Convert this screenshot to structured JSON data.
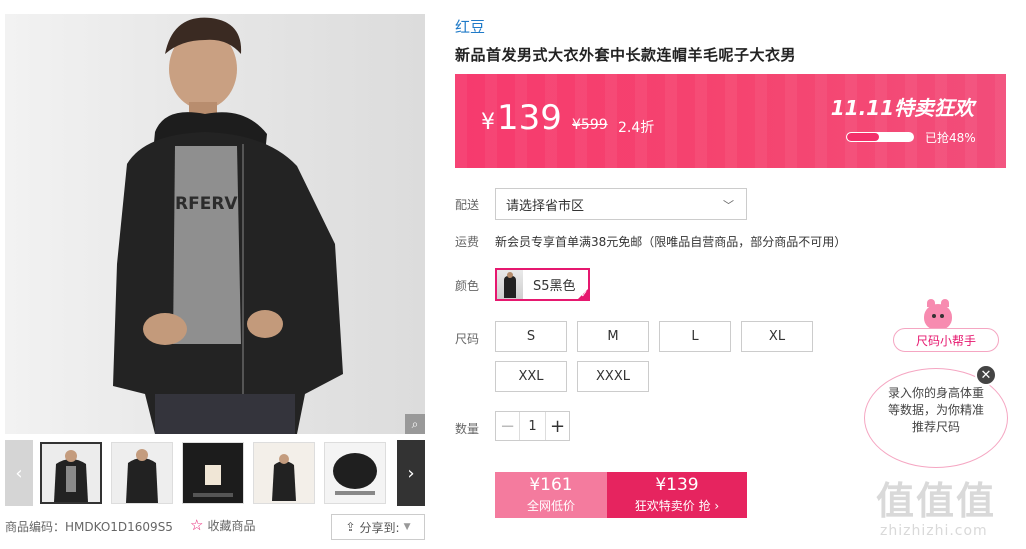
{
  "gallery": {
    "thumb_count": 6,
    "active_thumb": 0,
    "prev_arrow": "‹",
    "next_arrow": "›",
    "zoom_icon": "magnifier-icon"
  },
  "product": {
    "brand": "红豆",
    "title": "新品首发男式大衣外套中长款连帽羊毛呢子大衣男",
    "sku_label": "商品编码：HMDKO1D1609S5",
    "favorite_label": "收藏商品",
    "share_label": "分享到:"
  },
  "price": {
    "currency": "¥",
    "current": "139",
    "original": "¥599",
    "discount": "2.4折",
    "event_title": "11.11特卖狂欢",
    "sold_text": "已抢48%",
    "sold_fraction": 0.48
  },
  "delivery": {
    "label": "配送",
    "region_placeholder": "请选择省市区",
    "shipping_label": "运费",
    "shipping_text": "新会员专享首单满38元免邮（限唯品自营商品，部分商品不可用）"
  },
  "color": {
    "label": "颜色",
    "selected": "S5黑色"
  },
  "size": {
    "label": "尺码",
    "options": [
      "S",
      "M",
      "L",
      "XL",
      "XXL",
      "XXXL"
    ]
  },
  "quantity": {
    "label": "数量",
    "value": "1",
    "minus": "−",
    "plus": "+"
  },
  "buy": {
    "left_price": "¥161",
    "left_label": "全网低价",
    "right_price": "¥139",
    "right_label": "狂欢特卖价 抢 ›"
  },
  "size_helper": {
    "tag": "尺码小帮手",
    "bubble": "录入你的身高体重等数据，为你精准推荐尺码",
    "close": "✕"
  },
  "watermark": {
    "mark": "值值值",
    "url": "zhizhizhi.com"
  },
  "colors": {
    "accent": "#e6186f",
    "banner": "#f5446f",
    "brand_link": "#1f7ac8"
  }
}
